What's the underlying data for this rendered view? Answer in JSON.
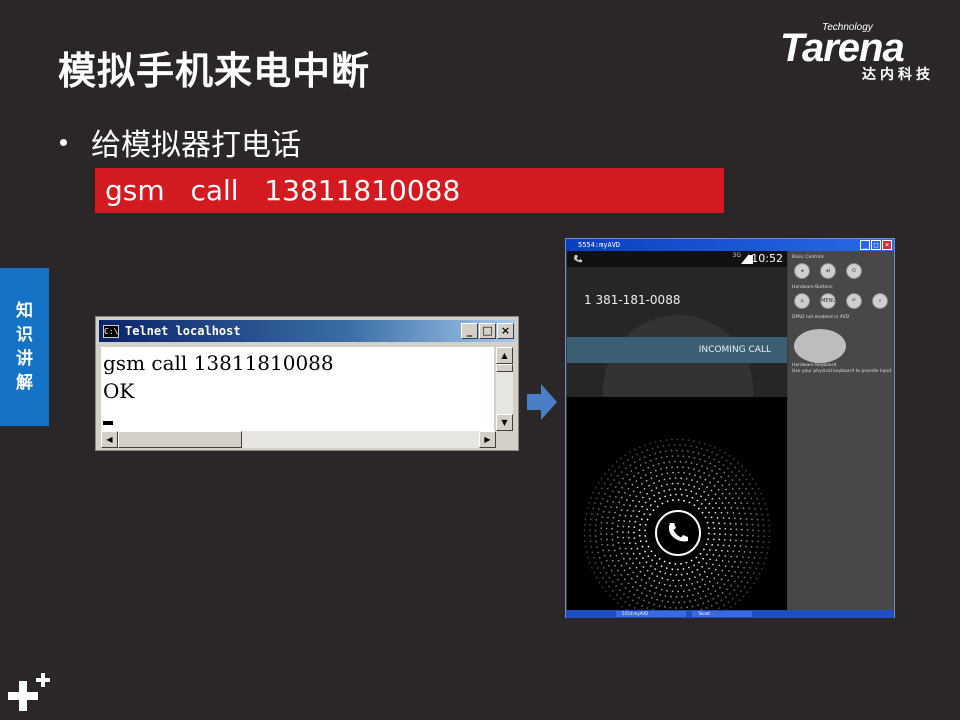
{
  "slide": {
    "title": "模拟手机来电中断",
    "bullet": "给模拟器打电话",
    "code": "gsm  call  13811810088",
    "side_tab": [
      "知",
      "识",
      "讲",
      "解"
    ]
  },
  "logo": {
    "small": "Technology",
    "word": "Tarena",
    "cn": "达内科技"
  },
  "telnet": {
    "title": "Telnet localhost",
    "icon_text": "C:\\",
    "lines": [
      "gsm call 13811810088",
      "OK"
    ],
    "buttons": {
      "minimize": "_",
      "maximize": "□",
      "close": "×"
    }
  },
  "emulator": {
    "title": "5554:myAVD",
    "status_time": "10:52",
    "network": "3G",
    "caller_number": "1 381-181-0088",
    "incoming_label": "INCOMING CALL",
    "panel": {
      "basic_controls": "Basic Controls",
      "hardware_buttons": "Hardware Buttons",
      "dpad_note": "DPAD not enabled in AVD",
      "keyboard_title": "Hardware Keyboard",
      "keyboard_note": "Use your physical keyboard to provide input",
      "menu_label": "MENU"
    },
    "taskbar_items": [
      "5554:myAVD",
      "Telnet"
    ]
  },
  "colors": {
    "background": "#2b2628",
    "code_bar": "#d41a21",
    "side_tab": "#1473c6",
    "incoming_bar": "#3d5f73"
  }
}
